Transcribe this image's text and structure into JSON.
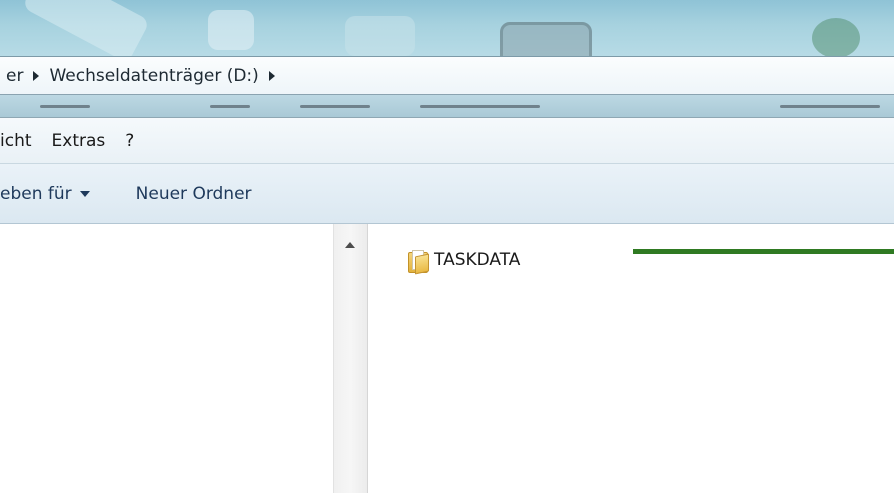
{
  "address_bar": {
    "crumbs": [
      "er",
      "Wechseldatenträger (D:)"
    ]
  },
  "menu_bar": {
    "items": [
      "icht",
      "Extras",
      "?"
    ]
  },
  "command_bar": {
    "share_label": "eben für",
    "new_folder_label": "Neuer Ordner"
  },
  "file_pane": {
    "items": [
      {
        "name": "TASKDATA",
        "type": "folder"
      }
    ]
  },
  "annotation": {
    "marker_color": "#2f7a22"
  },
  "icons": {
    "breadcrumb_separator": "chevron-right-icon",
    "dropdown": "chevron-down-icon",
    "folder": "folder-icon",
    "scroll_up": "scroll-up-arrow-icon"
  }
}
